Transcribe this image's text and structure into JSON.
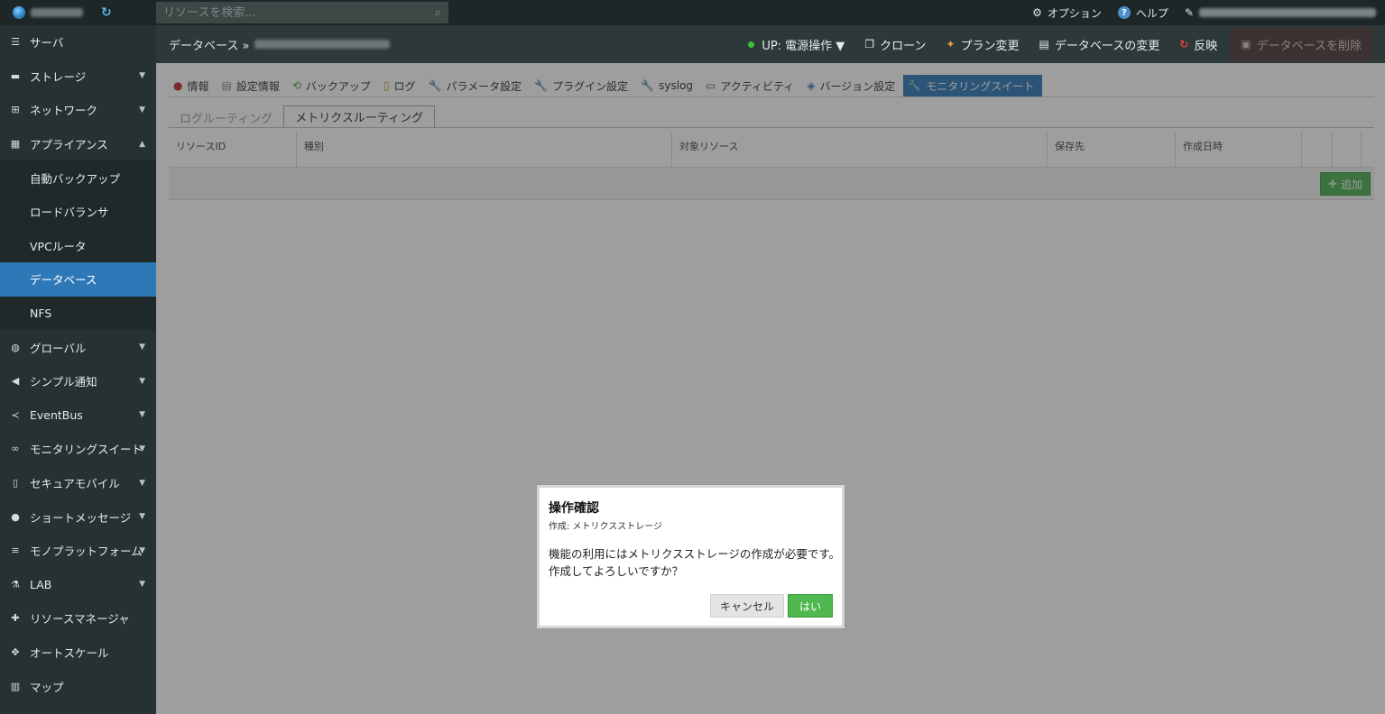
{
  "topbar": {
    "search_placeholder": "リソースを検索...",
    "options_label": "オプション",
    "help_label": "ヘルプ"
  },
  "sidebar": {
    "items": [
      {
        "label": "サーバ",
        "icon": "server-icon",
        "chevron": ""
      },
      {
        "label": "ストレージ",
        "icon": "storage-icon",
        "chevron": "⌄"
      },
      {
        "label": "ネットワーク",
        "icon": "network-icon",
        "chevron": "⌄"
      },
      {
        "label": "アプライアンス",
        "icon": "appliance-icon",
        "chevron": "⌃"
      }
    ],
    "sub_items": [
      {
        "label": "自動バックアップ"
      },
      {
        "label": "ロードバランサ"
      },
      {
        "label": "VPCルータ"
      },
      {
        "label": "データベース",
        "active": true
      },
      {
        "label": "NFS"
      }
    ],
    "items_after": [
      {
        "label": "グローバル",
        "icon": "globe-icon",
        "chevron": "⌄"
      },
      {
        "label": "シンプル通知",
        "icon": "megaphone-icon",
        "chevron": "⌄"
      },
      {
        "label": "EventBus",
        "icon": "share-icon",
        "chevron": "⌄"
      },
      {
        "label": "モニタリングスイート",
        "icon": "binoculars-icon",
        "chevron": "⌄"
      },
      {
        "label": "セキュアモバイル",
        "icon": "mobile-icon",
        "chevron": "⌄"
      },
      {
        "label": "ショートメッセージ",
        "icon": "chat-icon",
        "chevron": "⌄"
      },
      {
        "label": "モノプラットフォーム",
        "icon": "list-icon",
        "chevron": "⌄"
      },
      {
        "label": "LAB",
        "icon": "flask-icon",
        "chevron": "⌄"
      },
      {
        "label": "リソースマネージャ",
        "icon": "puzzle-icon",
        "chevron": ""
      },
      {
        "label": "オートスケール",
        "icon": "move-icon",
        "chevron": ""
      },
      {
        "label": "マップ",
        "icon": "map-icon",
        "chevron": ""
      }
    ]
  },
  "header": {
    "breadcrumb": "データベース »",
    "actions": {
      "power": "UP: 電源操作 ▼",
      "clone": "クローン",
      "plan": "プラン変更",
      "change_db": "データベースの変更",
      "apply": "反映",
      "delete": "データベースを削除"
    }
  },
  "tabs": [
    {
      "label": "情報",
      "icon": "info-icon"
    },
    {
      "label": "設定情報",
      "icon": "settings-info-icon"
    },
    {
      "label": "バックアップ",
      "icon": "backup-icon"
    },
    {
      "label": "ログ",
      "icon": "log-icon"
    },
    {
      "label": "パラメータ設定",
      "icon": "wrench-icon"
    },
    {
      "label": "プラグイン設定",
      "icon": "wrench-icon"
    },
    {
      "label": "syslog",
      "icon": "wrench-icon"
    },
    {
      "label": "アクティビティ",
      "icon": "monitor-icon"
    },
    {
      "label": "バージョン設定",
      "icon": "version-icon"
    },
    {
      "label": "モニタリングスイート",
      "icon": "wrench-icon",
      "active": true
    }
  ],
  "subtabs": [
    {
      "label": "ログルーティング"
    },
    {
      "label": "メトリクスルーティング",
      "active": true
    }
  ],
  "table": {
    "columns": [
      "リソースID",
      "種別",
      "対象リソース",
      "保存先",
      "作成日時",
      "",
      ""
    ],
    "add_label": "追加"
  },
  "modal": {
    "title": "操作確認",
    "subtitle": "作成: メトリクスストレージ",
    "message_line1": "機能の利用にはメトリクスストレージの作成が必要です。",
    "message_line2": "作成してよろしいですか？",
    "cancel_label": "キャンセル",
    "yes_label": "はい"
  }
}
